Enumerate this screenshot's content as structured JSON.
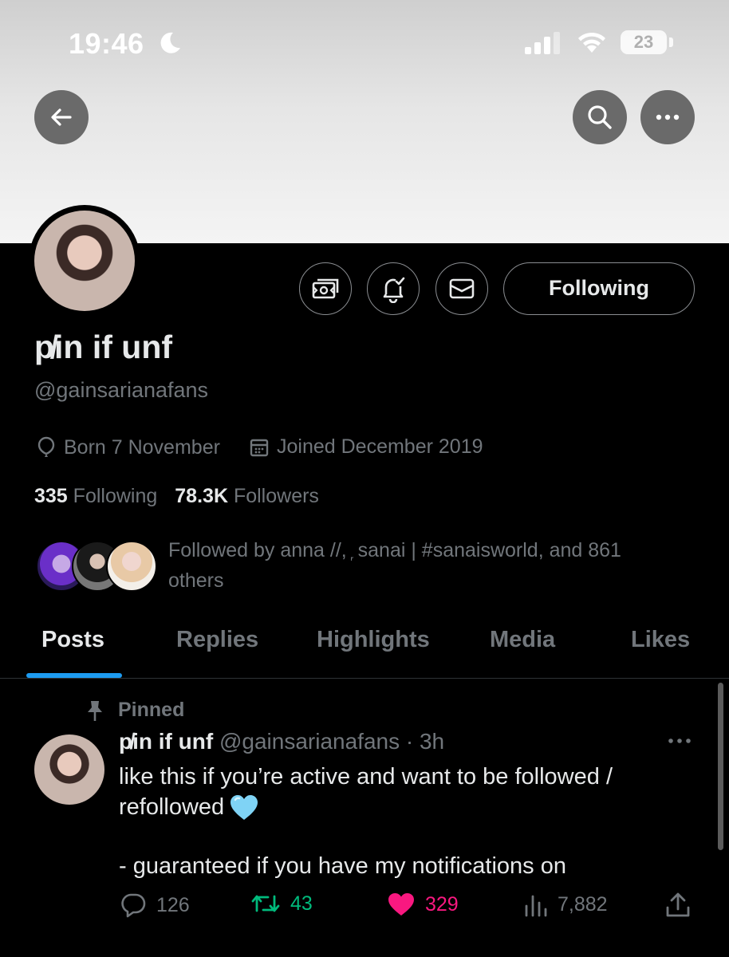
{
  "status_bar": {
    "time": "19:46",
    "battery": "23"
  },
  "profile": {
    "display_name": "p̸in if unf",
    "handle": "@gainsarianafans",
    "born": "Born 7 November",
    "joined": "Joined December 2019",
    "following_count": "335",
    "following_label": "Following",
    "followers_count": "78.3K",
    "followers_label": "Followers",
    "followed_by": "Followed by anna //, ᷊ sanai | #sanaisworld, and 861 others",
    "following_button": "Following"
  },
  "tabs": [
    {
      "label": "Posts",
      "active": true
    },
    {
      "label": "Replies",
      "active": false
    },
    {
      "label": "Highlights",
      "active": false
    },
    {
      "label": "Media",
      "active": false
    },
    {
      "label": "Likes",
      "active": false
    }
  ],
  "post": {
    "pinned_label": "Pinned",
    "author_name": "p̸in if unf",
    "author_handle_time": "@gainsarianafans · 3h",
    "text_line1": "like this if you’re active and want to be followed /",
    "text_line2": "refollowed",
    "text_line3": "- guaranteed if you have my notifications on",
    "replies": "126",
    "reposts": "43",
    "likes": "329",
    "views": "7,882"
  },
  "colors": {
    "accent": "#1d9bf0",
    "repost": "#00ba7c",
    "like": "#f91880",
    "secondary_text": "#71767b"
  }
}
